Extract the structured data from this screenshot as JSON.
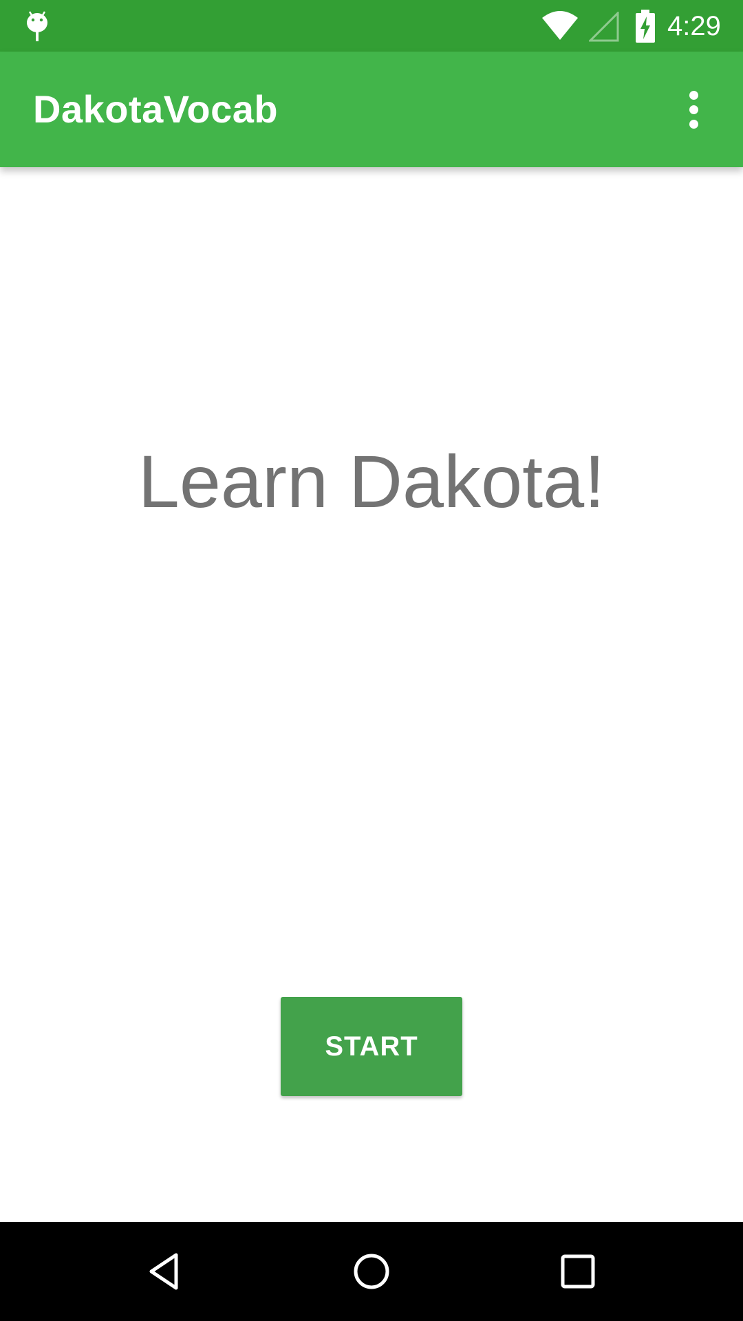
{
  "status_bar": {
    "time": "4:29",
    "icons": [
      "android-debug-icon",
      "wifi-icon",
      "cell-signal-icon",
      "battery-charging-icon"
    ]
  },
  "app_bar": {
    "title": "DakotaVocab",
    "overflow_icon": "more-vert-icon"
  },
  "main": {
    "headline": "Learn Dakota!",
    "start_label": "START"
  },
  "nav_bar": {
    "icons": [
      "back-icon",
      "home-icon",
      "recents-icon"
    ]
  },
  "colors": {
    "status_bar": "#339f34",
    "app_bar": "#42b54a",
    "button": "#43a24b",
    "headline_text": "#737373",
    "nav_bar": "#000000"
  }
}
